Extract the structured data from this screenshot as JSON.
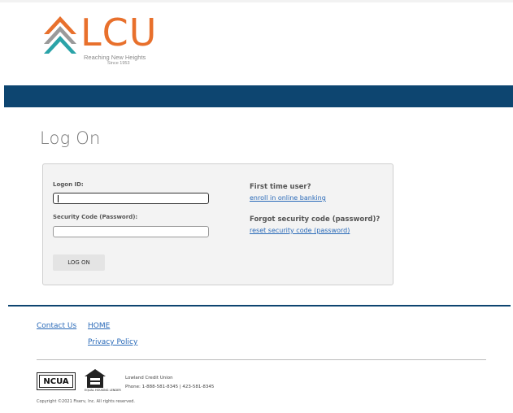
{
  "header": {
    "logo_text": "LCU",
    "tagline": "Reaching New Heights",
    "since": "Since 1953",
    "colors": {
      "logo_orange": "#e8702c",
      "logo_teal": "#2aa3a8",
      "banner": "#0d4570"
    }
  },
  "page": {
    "title": "Log On"
  },
  "form": {
    "logon_id_label": "Logon ID:",
    "logon_id_value": "",
    "password_label": "Security Code (Password):",
    "password_value": "",
    "submit_label": "LOG ON"
  },
  "help": {
    "first_time_heading": "First time user?",
    "enroll_link": "enroll in online banking",
    "forgot_heading": "Forgot security code (password)?",
    "reset_link": "reset security code (password)"
  },
  "footer": {
    "links": {
      "contact": "Contact Us",
      "home": "HOME",
      "privacy": "Privacy Policy"
    },
    "ncua": "NCUA",
    "equal_housing": "EQUAL HOUSING LENDER",
    "cu_name": "Lowland Credit Union",
    "phone": "Phone: 1-888-581-8345   |   423-581-8345",
    "copyright": "Copyright ©2021 Fiserv, Inc. All rights reserved."
  }
}
